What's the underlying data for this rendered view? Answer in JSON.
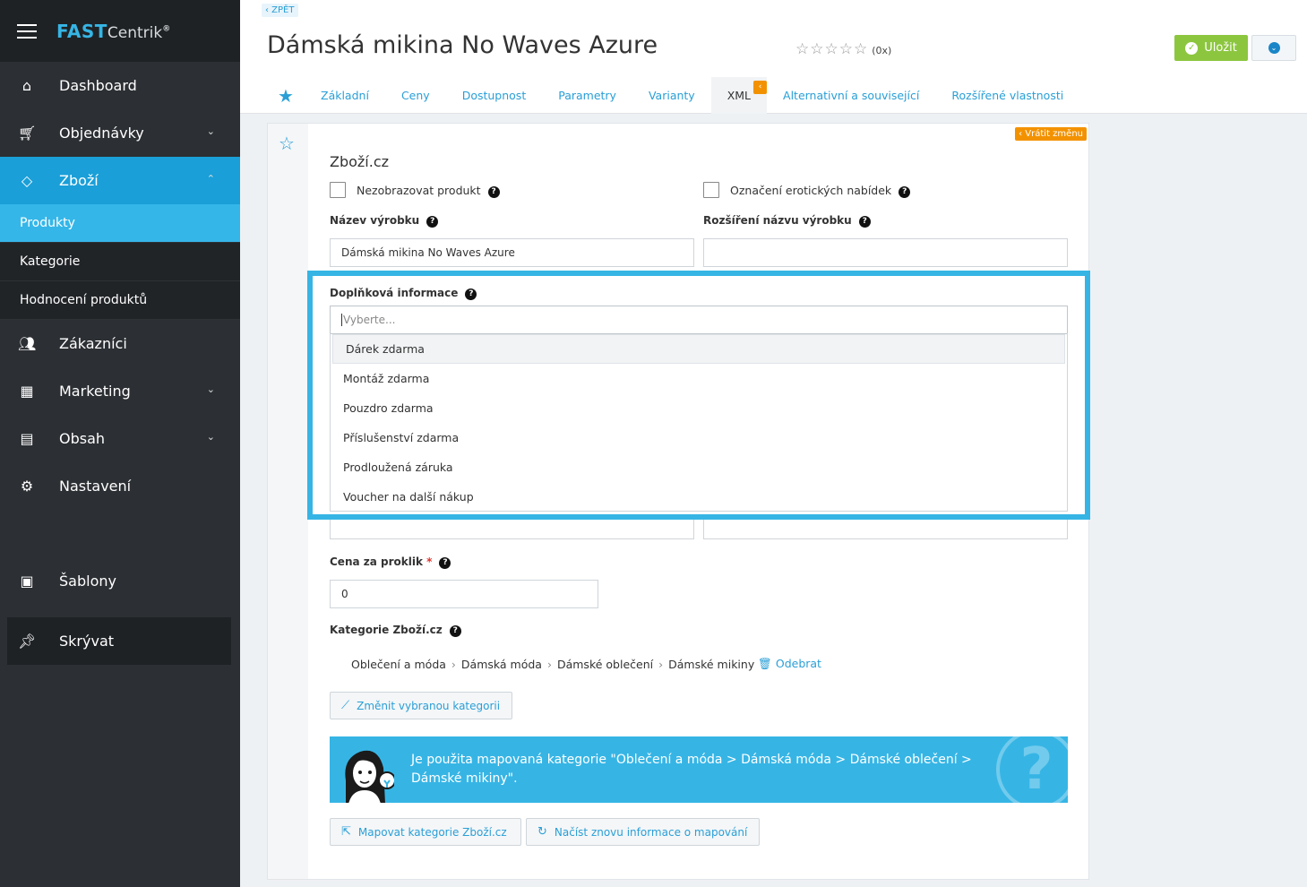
{
  "sidebar": {
    "logo_fast": "FAST",
    "logo_centrik": "Centrik",
    "logo_reg": "®",
    "items": [
      {
        "label": "Dashboard"
      },
      {
        "label": "Objednávky"
      },
      {
        "label": "Zboží"
      },
      {
        "label": "Zákazníci"
      },
      {
        "label": "Marketing"
      },
      {
        "label": "Obsah"
      },
      {
        "label": "Nastavení"
      },
      {
        "label": "Šablony"
      },
      {
        "label": "Skrývat"
      }
    ],
    "sub_items": [
      {
        "label": "Produkty"
      },
      {
        "label": "Kategorie"
      },
      {
        "label": "Hodnocení produktů"
      }
    ]
  },
  "header": {
    "back": "‹ ZPĚT",
    "title": "Dámská mikina No Waves Azure",
    "rating_stars": "☆☆☆☆☆",
    "rating_count": "(0x)",
    "save_label": "Uložit",
    "tabs": [
      {
        "label": "Základní"
      },
      {
        "label": "Ceny"
      },
      {
        "label": "Dostupnost"
      },
      {
        "label": "Parametry"
      },
      {
        "label": "Varianty"
      },
      {
        "label": "XML"
      },
      {
        "label": "Alternativní a související"
      },
      {
        "label": "Rozšířené vlastnosti"
      }
    ],
    "xml_badge": "‹"
  },
  "content": {
    "revert": "‹ Vrátit změnu",
    "section_title": "Zboží.cz",
    "hide_product": "Nezobrazovat produkt",
    "erotic": "Označení erotických nabídek",
    "name_label": "Název výrobku",
    "name_value": "Dámská mikina No Waves Azure",
    "name_ext_label": "Rozšíření názvu výrobku",
    "name_ext_value": "",
    "extra_info": {
      "label": "Doplňková informace",
      "placeholder": "Vyberte...",
      "options": [
        "Dárek zdarma",
        "Montáž zdarma",
        "Pouzdro zdarma",
        "Příslušenství zdarma",
        "Prodloužená záruka",
        "Voucher na další nákup"
      ]
    },
    "cpc_label": "Cena za proklik",
    "cpc_required": "*",
    "cpc_value": "0",
    "category_label": "Kategorie Zboží.cz",
    "category_path": [
      "Oblečení a móda",
      "Dámská móda",
      "Dámské oblečení",
      "Dámské mikiny"
    ],
    "remove": "Odebrat",
    "change_category": "Změnit vybranou kategorii",
    "info_text": "Je použita mapovaná kategorie \"Oblečení a móda > Dámská móda > Dámské oblečení > Dámské mikiny\".",
    "map_button": "Mapovat kategorie Zboží.cz",
    "reload_button": "Načíst znovu informace o mapování"
  },
  "colors": {
    "accent": "#36b5e5",
    "sidebar": "#2c2f33",
    "save": "#8cc63f",
    "orange": "#f39200"
  }
}
